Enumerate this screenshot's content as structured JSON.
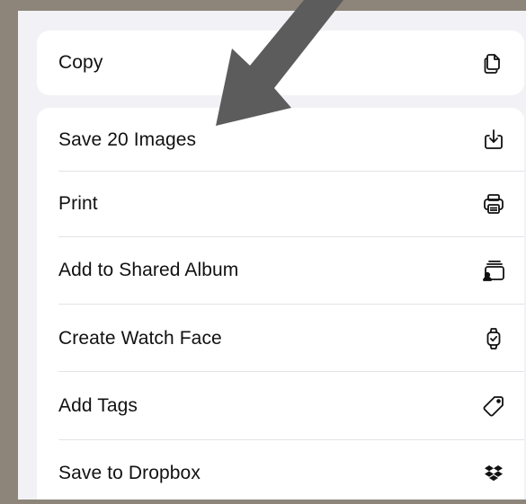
{
  "share_sheet": {
    "top_group": {
      "copy_label": "Copy",
      "copy_icon": "copy-icon"
    },
    "actions": [
      {
        "label": "Save 20 Images",
        "icon": "save-images-icon"
      },
      {
        "label": "Print",
        "icon": "printer-icon"
      },
      {
        "label": "Add to Shared Album",
        "icon": "shared-album-icon"
      },
      {
        "label": "Create Watch Face",
        "icon": "watch-icon"
      },
      {
        "label": "Add Tags",
        "icon": "tag-icon"
      },
      {
        "label": "Save to Dropbox",
        "icon": "dropbox-icon"
      }
    ]
  },
  "annotation": {
    "arrow_color": "#5c5c5c",
    "points_to": "Save 20 Images"
  },
  "colors": {
    "background": "#8d857a",
    "sheet": "#f2f2f6",
    "row": "#ffffff",
    "text": "#111111"
  }
}
